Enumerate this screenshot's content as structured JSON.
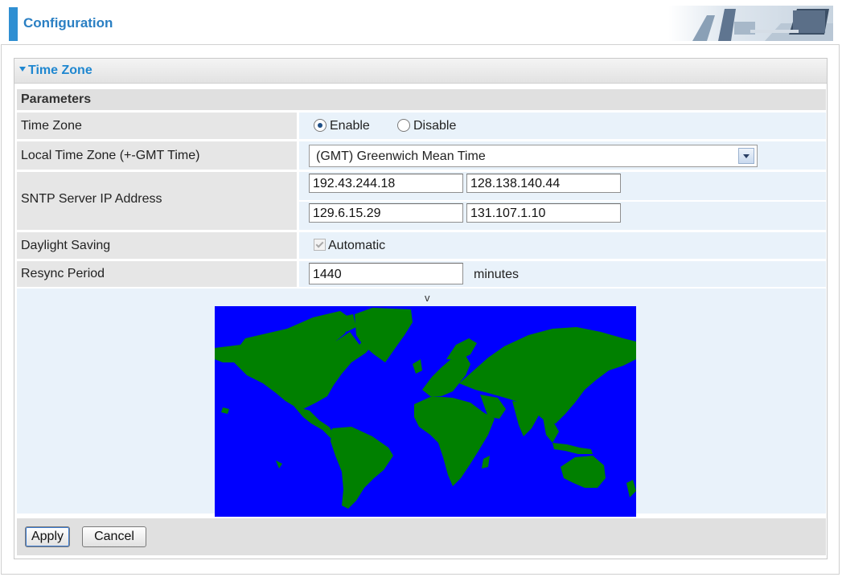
{
  "header": {
    "title": "Configuration",
    "photo_icon": "office-desk-photo"
  },
  "panel": {
    "title": "Time Zone",
    "caret_icon": "triangle-down-icon",
    "section_label": "Parameters",
    "fields": {
      "time_zone": {
        "label": "Time Zone",
        "options": [
          "Enable",
          "Disable"
        ],
        "selected": "Enable"
      },
      "local_time_zone": {
        "label": "Local Time Zone (+-GMT Time)",
        "value": "(GMT) Greenwich Mean Time"
      },
      "sntp": {
        "label": "SNTP Server IP Address",
        "servers": [
          "192.43.244.18",
          "128.138.140.44",
          "129.6.15.29",
          "131.107.1.10"
        ]
      },
      "daylight_saving": {
        "label": "Daylight Saving",
        "option": "Automatic",
        "checked": true
      },
      "resync": {
        "label": "Resync Period",
        "value": "1440",
        "unit": "minutes"
      }
    },
    "map": {
      "marker": "v",
      "ocean_color": "#0000ff",
      "land_color": "#008000"
    },
    "buttons": {
      "apply": "Apply",
      "cancel": "Cancel"
    }
  }
}
